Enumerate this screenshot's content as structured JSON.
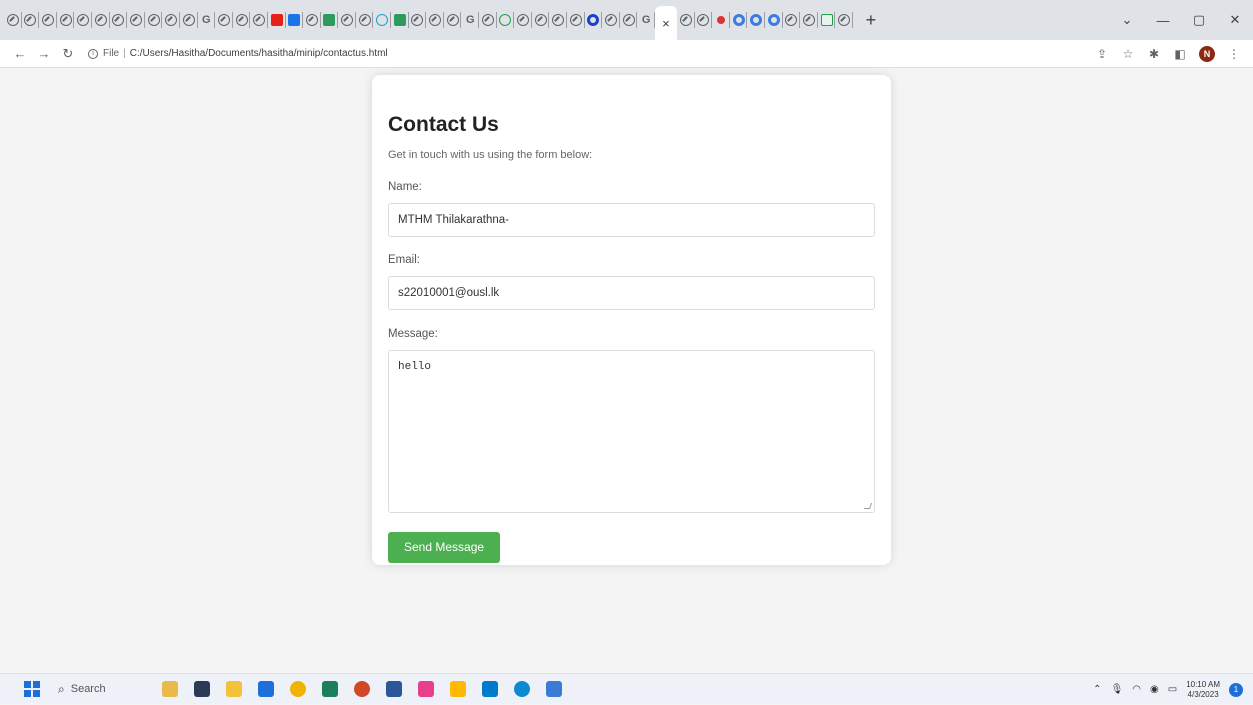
{
  "browser": {
    "address": "C:/Users/Hasitha/Documents/hasitha/minip/contactus.html",
    "file_label": "File",
    "tab_close": "×",
    "new_tab": "+",
    "window_controls": [
      "⌄",
      "—",
      "▢",
      "✕"
    ]
  },
  "page": {
    "title": "Contact Us",
    "subtitle": "Get in touch with us using the form below:",
    "name_label": "Name:",
    "name_value": "MTHM Thilakarathna-",
    "email_label": "Email:",
    "email_value": "s22010001@ousl.lk",
    "message_label": "Message:",
    "message_value": "hello",
    "submit_label": "Send Message",
    "submit_color": "#4caf50"
  },
  "taskbar": {
    "search_label": "Search",
    "time": "10:10 AM",
    "date": "4/3/2023"
  },
  "profile_initial": "N"
}
